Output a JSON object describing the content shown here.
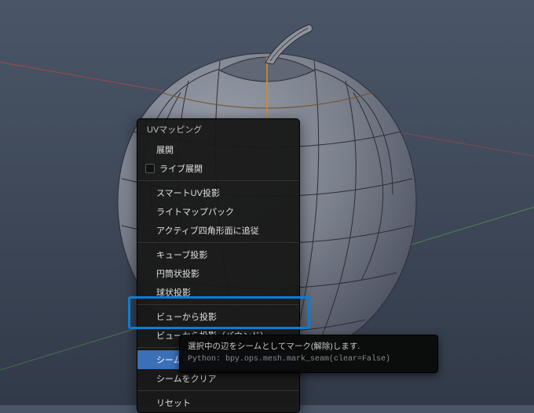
{
  "menu": {
    "title": "UVマッピング",
    "items": {
      "unwrap": "展開",
      "live_unwrap": "ライブ展開",
      "smart_uv": "スマートUV投影",
      "lightmap": "ライトマップパック",
      "follow_quads": "アクティブ四角形面に追従",
      "cube": "キューブ投影",
      "cylinder": "円筒状投影",
      "sphere": "球状投影",
      "from_view": "ビューから投影",
      "from_view_bounds": "ビューから投影（バウンド）",
      "mark_seam": "シームをマーク",
      "clear_seam": "シームをクリア",
      "reset": "リセット"
    }
  },
  "tooltip": {
    "desc": "選択中の辺をシームとしてマーク(解除)します.",
    "python": "Python: bpy.ops.mesh.mark_seam(clear=False)"
  }
}
